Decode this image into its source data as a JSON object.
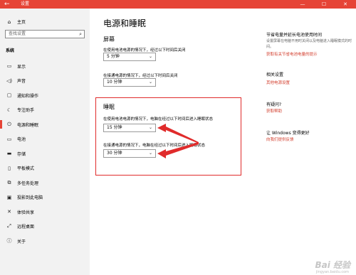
{
  "titlebar": {
    "title": "设置",
    "back_icon": "←",
    "minimize": "—",
    "maximize": "☐",
    "close": "✕"
  },
  "sidebar": {
    "home": "主页",
    "search_placeholder": "查找设置",
    "section": "系统",
    "items": [
      {
        "label": "显示",
        "icon": "▭"
      },
      {
        "label": "声音",
        "icon": "◁)"
      },
      {
        "label": "通知和操作",
        "icon": "▢"
      },
      {
        "label": "专注助手",
        "icon": "☾"
      },
      {
        "label": "电源和睡眠",
        "icon": "⏻"
      },
      {
        "label": "电池",
        "icon": "▭"
      },
      {
        "label": "存储",
        "icon": "▬"
      },
      {
        "label": "平板模式",
        "icon": "▯"
      },
      {
        "label": "多任务处理",
        "icon": "⧉"
      },
      {
        "label": "投影到此电脑",
        "icon": "▣"
      },
      {
        "label": "体验共享",
        "icon": "✕"
      },
      {
        "label": "远程桌面",
        "icon": "⤢"
      },
      {
        "label": "关于",
        "icon": "ⓘ"
      }
    ]
  },
  "main": {
    "title": "电源和睡眠",
    "screen": {
      "heading": "屏幕",
      "battery_desc": "在使用电池电源的情况下，经过以下时间后关闭",
      "battery_value": "5 分钟",
      "plugged_desc": "在接通电源的情况下，经过以下时间后关闭",
      "plugged_value": "10 分钟"
    },
    "sleep": {
      "heading": "睡眠",
      "battery_desc": "在使用电池电源的情况下，电脑在经过以下时间后进入睡眠状态",
      "battery_value": "15 分钟",
      "plugged_desc": "在接通电源的情况下，电脑在经过以下时间后进入睡眠状态",
      "plugged_value": "30 分钟"
    }
  },
  "right": {
    "saver_heading": "节省电量并延长电池使用时间",
    "saver_text": "设置屏幕在电脑不用时关闭以及电脑进入睡眠模式的时间。",
    "saver_link": "获取有关节省电池电量的提示",
    "related_heading": "相关设置",
    "related_link": "其他电源设置",
    "question_heading": "有疑问?",
    "question_link": "获取帮助",
    "better_heading": "让 Windows 变得更好",
    "better_link": "向我们提供反馈"
  },
  "watermark": {
    "logo": "Bai 经验",
    "url": "jingyan.baidu.com"
  }
}
